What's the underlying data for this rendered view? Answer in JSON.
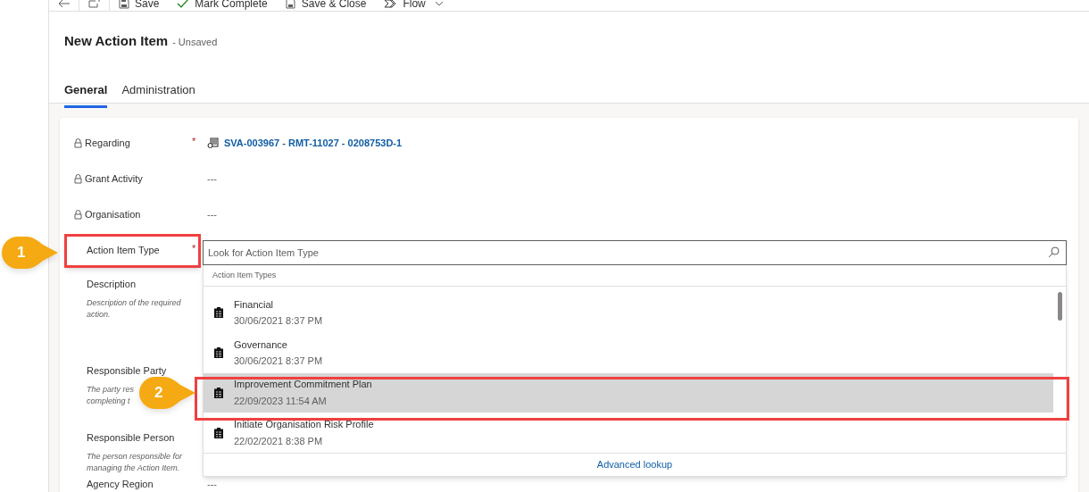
{
  "command_bar": [
    {
      "kind": "save",
      "label": "Save"
    },
    {
      "kind": "check",
      "label": "Mark Complete"
    },
    {
      "kind": "save_close",
      "label": "Save & Close"
    },
    {
      "kind": "flow",
      "label": "Flow"
    }
  ],
  "header": {
    "title": "New Action Item",
    "status": "- Unsaved"
  },
  "tabs": [
    {
      "label": "General",
      "selected": true
    },
    {
      "label": "Administration",
      "selected": false
    }
  ],
  "fields": [
    {
      "label": "Regarding",
      "locked": true,
      "required": true,
      "value": "SVA-003967 - RMT-11027 - 0208753D-1",
      "kind": "link"
    },
    {
      "label": "Grant Activity",
      "locked": true,
      "required": false,
      "value": "---",
      "kind": "text"
    },
    {
      "label": "Organisation",
      "locked": true,
      "required": false,
      "value": "---",
      "kind": "text"
    },
    {
      "label": "Action Item Type",
      "locked": false,
      "required": true,
      "kind": "lookup"
    },
    {
      "label": "Description",
      "locked": false,
      "required": false,
      "description": "Description of the required action.",
      "kind": "hidden"
    },
    {
      "label": "Responsible Party",
      "locked": false,
      "required": false,
      "description_lines": [
        "The party res",
        "completing t"
      ],
      "kind": "hidden"
    },
    {
      "label": "Responsible Person",
      "locked": false,
      "required": false,
      "description": "The person responsible for managing the Action Item.",
      "kind": "hidden"
    },
    {
      "label": "Agency Region",
      "locked": false,
      "required": false,
      "value": "---",
      "kind": "text"
    }
  ],
  "lookup": {
    "placeholder": "Look for Action Item Type",
    "header": "Action Item Types",
    "items": [
      {
        "title": "Financial",
        "date": "30/06/2021 8:37 PM",
        "selected": false
      },
      {
        "title": "Governance",
        "date": "30/06/2021 8:37 PM",
        "selected": false
      },
      {
        "title": "Improvement Commitment Plan",
        "date": "22/09/2023 11:54 AM",
        "selected": true
      },
      {
        "title": "Initiate Organisation Risk Profile",
        "date": "22/02/2021 8:38 PM",
        "selected": false
      }
    ],
    "footer_link": "Advanced lookup"
  },
  "required_marker": "*",
  "callouts": [
    {
      "number": "1"
    },
    {
      "number": "2"
    }
  ]
}
